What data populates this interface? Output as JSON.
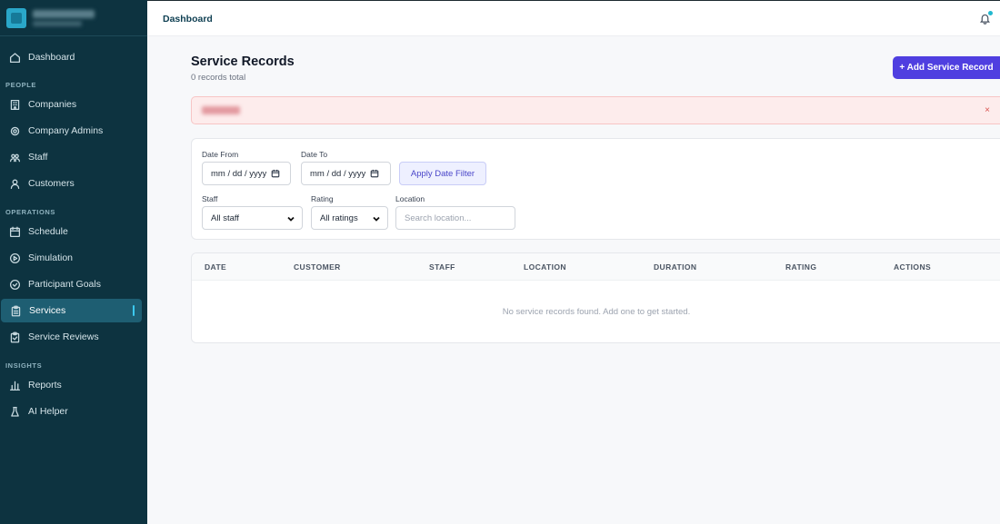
{
  "sidebar": {
    "items": [
      {
        "label": "Dashboard",
        "icon": "home-icon"
      },
      {
        "label": "Companies",
        "icon": "building-icon"
      },
      {
        "label": "Company Admins",
        "icon": "user-cog-icon"
      },
      {
        "label": "Staff",
        "icon": "staff-icon"
      },
      {
        "label": "Customers",
        "icon": "user-icon"
      },
      {
        "label": "Schedule",
        "icon": "calendar-icon"
      },
      {
        "label": "Simulation",
        "icon": "play-circle-icon"
      },
      {
        "label": "Participant Goals",
        "icon": "check-circle-icon"
      },
      {
        "label": "Services",
        "icon": "clipboard-icon"
      },
      {
        "label": "Service Reviews",
        "icon": "clipboard-check-icon"
      },
      {
        "label": "Reports",
        "icon": "bar-chart-icon"
      },
      {
        "label": "AI Helper",
        "icon": "flask-icon"
      }
    ],
    "sections": [
      "PEOPLE",
      "OPERATIONS",
      "INSIGHTS"
    ],
    "active": "Services"
  },
  "topbar": {
    "title": "Dashboard"
  },
  "main": {
    "title": "Service Records",
    "subtitle": "0 records total",
    "add_button": "+ Add Service Record"
  },
  "filters": {
    "date_from_label": "Date From",
    "date_from_value": "mm / dd / yyyy",
    "date_to_label": "Date To",
    "date_to_value": "mm / dd / yyyy",
    "apply_button": "Apply Date Filter",
    "staff_label": "Staff",
    "staff_value": "All staff",
    "rating_label": "Rating",
    "rating_value": "All ratings",
    "location_label": "Location",
    "location_placeholder": "Search location..."
  },
  "alert": {
    "close": "×"
  },
  "table": {
    "columns": [
      "DATE",
      "CUSTOMER",
      "STAFF",
      "LOCATION",
      "DURATION",
      "RATING",
      "ACTIONS"
    ],
    "empty_message": "No service records found. Add one to get started."
  },
  "colors": {
    "sidebar_bg": "#0d3340",
    "active_item": "#1e5e72",
    "primary_button": "#4f3fe0",
    "alert_bg": "#fdecec"
  }
}
